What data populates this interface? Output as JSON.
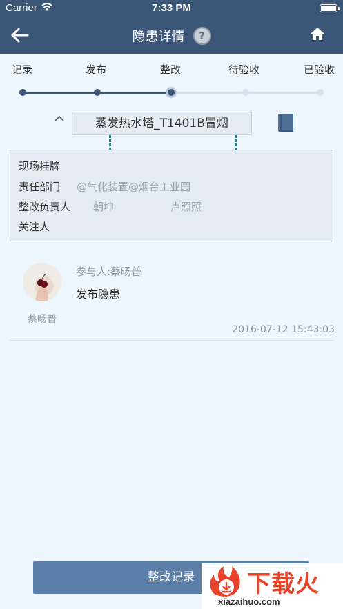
{
  "status_bar": {
    "carrier": "Carrier",
    "time": "7:33 PM"
  },
  "navbar": {
    "title": "隐患详情",
    "help_glyph": "?"
  },
  "steps": [
    {
      "label": "记录",
      "state": "done"
    },
    {
      "label": "发布",
      "state": "done"
    },
    {
      "label": "整改",
      "state": "current"
    },
    {
      "label": "待验收",
      "state": "todo"
    },
    {
      "label": "已验收",
      "state": "todo"
    }
  ],
  "hazard": {
    "title": "蒸发热水塔_T1401B冒烟"
  },
  "info": {
    "onsite_label": "现场挂牌",
    "dept_label": "责任部门",
    "dept_value": "@气化装置@烟台工业园",
    "owner_label": "整改负责人",
    "owner_value_1": "朝坤",
    "owner_value_2": "卢照照",
    "followers_label": "关注人"
  },
  "record": {
    "avatar_name": "蔡旸普",
    "participant": "参与人:蔡旸普",
    "action": "发布隐患",
    "timestamp": "2016-07-12 15:43:03"
  },
  "bottom_button": {
    "label": "整改记录"
  },
  "watermark": {
    "text": "下载火",
    "url": "xiazaihuo.com"
  },
  "colors": {
    "nav_bg": "#3c5677",
    "page_bg": "#eef6fd",
    "button_bg": "#5a7ea7",
    "watermark_red": "#e8432a"
  }
}
